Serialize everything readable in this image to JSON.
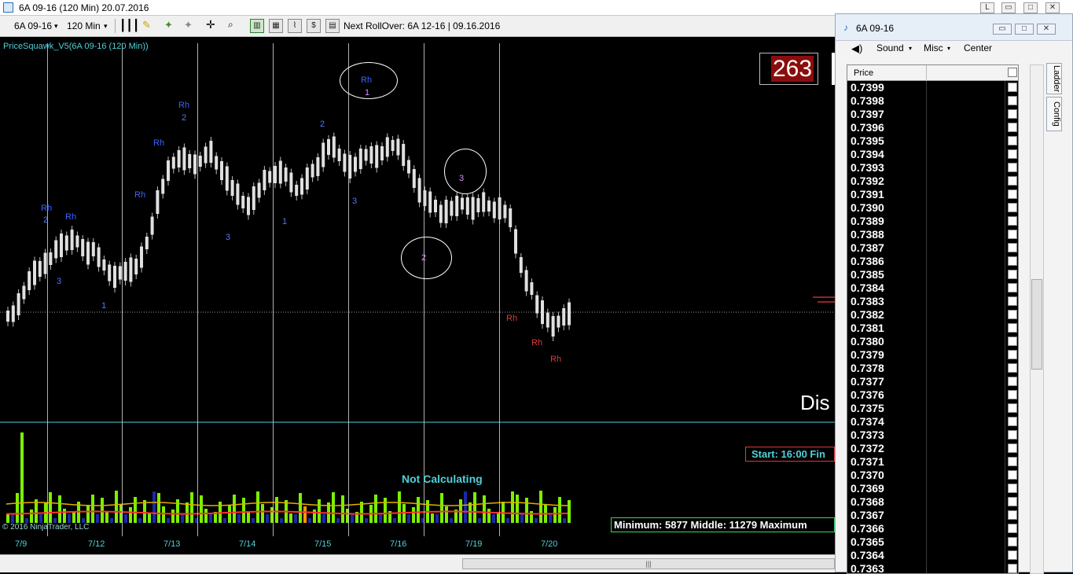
{
  "window": {
    "title": "6A 09-16 (120 Min)  20.07.2016",
    "btn_l": "L",
    "btn_min": "▭",
    "btn_max": "□",
    "btn_close": "✕"
  },
  "toolbar": {
    "instrument": "6A 09-16",
    "period": "120 Min",
    "rollover": "Next RollOver:  6A 12-16 | 09.16.2016"
  },
  "chart": {
    "indicator_title": "PriceSquawk_V5(6A 09-16 (120 Min))",
    "counter": "263",
    "disabled_text": "Dis",
    "start_box": "Start: 16:00 Fin",
    "not_calculating": "Not Calculating",
    "min_box": "Minimum: 5877  Middle: 11279  Maximum",
    "copyright": "© 2016 NinjaTrader, LLC",
    "x_labels": [
      "7/9",
      "7/12",
      "7/13",
      "7/14",
      "7/15",
      "7/16",
      "7/19",
      "7/20"
    ],
    "annotations": [
      {
        "t": "Rh",
        "c": "blue"
      },
      {
        "t": "2",
        "c": "blue2"
      },
      {
        "t": "Rh",
        "c": "blue"
      },
      {
        "t": "3",
        "c": "blue2"
      },
      {
        "t": "1",
        "c": "blue2"
      },
      {
        "t": "Rh",
        "c": "blue"
      },
      {
        "t": "Rh",
        "c": "blue"
      },
      {
        "t": "2",
        "c": "blue2"
      },
      {
        "t": "Rh",
        "c": "blue"
      },
      {
        "t": "3",
        "c": "blue2"
      },
      {
        "t": "1",
        "c": "blue2"
      },
      {
        "t": "2",
        "c": "blue2"
      },
      {
        "t": "3",
        "c": "blue2"
      },
      {
        "t": "Rh",
        "c": "blue"
      },
      {
        "t": "1",
        "c": "pink"
      },
      {
        "t": "3",
        "c": "pink"
      },
      {
        "t": "2",
        "c": "pink"
      },
      {
        "t": "Rh",
        "c": "red"
      },
      {
        "t": "Rh",
        "c": "red"
      },
      {
        "t": "Rh",
        "c": "red"
      }
    ],
    "colors": {
      "up_volume": "#7cf000",
      "down_volume": "#1d28a8",
      "spike_volume": "#ff9800",
      "signal": "#4fd1d9"
    }
  },
  "ladder": {
    "title": "6A 09-16",
    "sound": "Sound",
    "misc": "Misc",
    "center": "Center",
    "tab_ladder": "Ladder",
    "tab_config": "Config",
    "col_price": "Price",
    "prices": [
      "0.7399",
      "0.7398",
      "0.7397",
      "0.7396",
      "0.7395",
      "0.7394",
      "0.7393",
      "0.7392",
      "0.7391",
      "0.7390",
      "0.7389",
      "0.7388",
      "0.7387",
      "0.7386",
      "0.7385",
      "0.7384",
      "0.7383",
      "0.7382",
      "0.7381",
      "0.7380",
      "0.7379",
      "0.7378",
      "0.7377",
      "0.7376",
      "0.7375",
      "0.7374",
      "0.7373",
      "0.7372",
      "0.7371",
      "0.7370",
      "0.7369",
      "0.7368",
      "0.7367",
      "0.7366",
      "0.7365",
      "0.7364",
      "0.7363"
    ]
  }
}
